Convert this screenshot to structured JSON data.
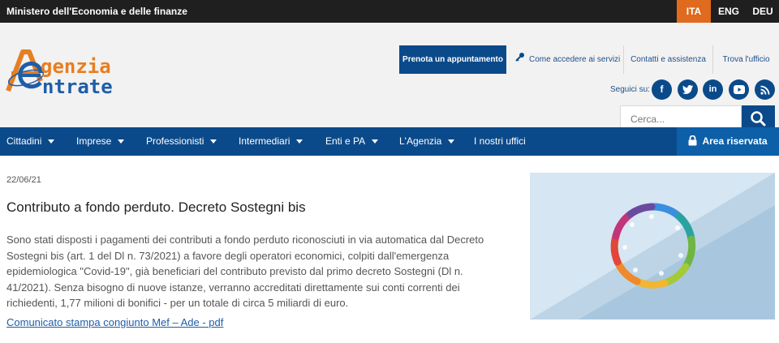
{
  "topbar": {
    "ministry": "Ministero dell'Economia e delle finanze",
    "languages": [
      "ITA",
      "ENG",
      "DEU"
    ],
    "active_language": "ITA"
  },
  "brand": {
    "line1": "genzia",
    "line2": "ntrate",
    "colors": {
      "orange": "#e67e22",
      "blue": "#1f5da8"
    }
  },
  "services": {
    "prenota": "Prenota un appuntamento",
    "come": "Come accedere ai servizi",
    "contatti": "Contatti e assistenza",
    "trova": "Trova l'ufficio"
  },
  "social": {
    "label": "Seguici su:",
    "icons": [
      "facebook-icon",
      "twitter-icon",
      "linkedin-icon",
      "youtube-icon",
      "rss-icon"
    ]
  },
  "search": {
    "placeholder": "Cerca..."
  },
  "nav": {
    "items": [
      "Cittadini",
      "Imprese",
      "Professionisti",
      "Intermediari",
      "Enti e PA",
      "L'Agenzia",
      "I nostri uffici"
    ],
    "area_riservata": "Area riservata"
  },
  "article": {
    "date": "22/06/21",
    "title": "Contributo a fondo perduto. Decreto Sostegni bis",
    "body": "Sono stati disposti i pagamenti dei contributi a fondo perduto riconosciuti in via automatica dal Decreto Sostegni bis (art. 1 del Dl n. 73/2021) a favore degli operatori economici, colpiti dall'emergenza epidemiologica \"Covid-19\", già beneficiari del contributo previsto dal primo decreto Sostegni (Dl n. 41/2021). Senza bisogno di nuove istanze, verranno accreditati direttamente sui conti correnti dei richiedenti, 1,77 milioni di bonifici - per un totale di circa 5 miliardi di euro.",
    "link": "Comunicato stampa congiunto Mef – Ade - pdf"
  },
  "colors": {
    "primary": "#0b4a8a",
    "accent": "#e06a1e",
    "topbar": "#1f1f1f"
  }
}
